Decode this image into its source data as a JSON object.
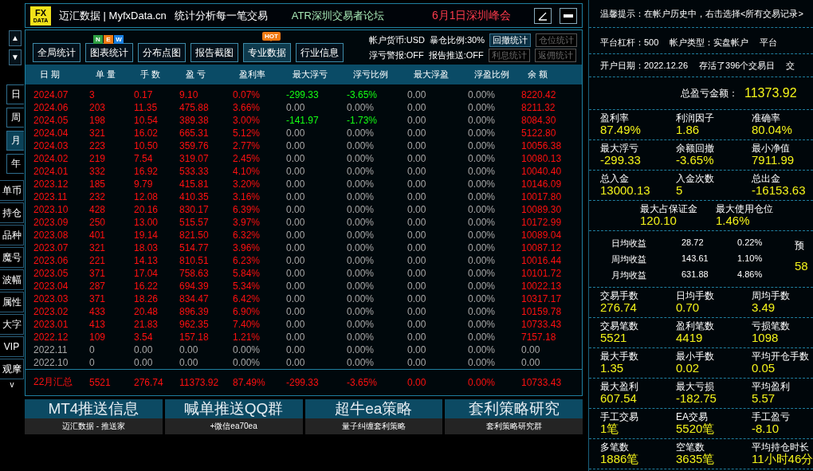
{
  "side_strip": {
    "arrows": [
      "▲",
      "▼"
    ],
    "period_tabs": [
      {
        "label": "日",
        "selected": false
      },
      {
        "label": "周",
        "selected": false
      },
      {
        "label": "月",
        "selected": true
      },
      {
        "label": "年",
        "selected": false
      }
    ],
    "items": [
      "单币",
      "持仓",
      "品种",
      "魔号",
      "波幅",
      "属性",
      "大字",
      "VIP",
      "观摩"
    ],
    "more": "v"
  },
  "title_bar": {
    "logo": {
      "top": "FX",
      "bottom": "DATA"
    },
    "brand": "迈汇数据 | MyfxData.cn",
    "slogan": "统计分析每一笔交易",
    "forum": "ATR深圳交易者论坛",
    "event": "6月1日深圳峰会"
  },
  "toolbar": {
    "tabs": [
      {
        "label": "全局统计",
        "selected": false
      },
      {
        "label": "图表统计",
        "selected": false,
        "badges": [
          {
            "text": "N",
            "color": "#2ea043"
          },
          {
            "text": "E",
            "color": "#f07a12"
          },
          {
            "text": "W",
            "color": "#1a7fe0"
          }
        ]
      },
      {
        "label": "分布点图",
        "selected": false
      },
      {
        "label": "报告截图",
        "selected": false
      },
      {
        "label": "专业数据",
        "selected": true,
        "badges": [
          {
            "text": "HOT",
            "color": "#f07a12"
          }
        ]
      },
      {
        "label": "行业信息",
        "selected": false
      }
    ],
    "info": [
      [
        "帐户货币:USD",
        "暴仓比例:30%"
      ],
      [
        "浮亏警报:OFF",
        "报告推送:OFF"
      ]
    ],
    "buttons": [
      [
        {
          "label": "回撤统计",
          "disabled": false
        },
        {
          "label": "仓位统计",
          "disabled": true
        }
      ],
      [
        {
          "label": "利息统计",
          "disabled": true
        },
        {
          "label": "返佣统计",
          "disabled": true
        }
      ]
    ]
  },
  "table": {
    "columns": [
      "日 期",
      "单 量",
      "手 数",
      "盈 亏",
      "盈利率",
      "最大浮亏",
      "浮亏比例",
      "最大浮盈",
      "浮盈比例",
      "余 额"
    ],
    "rows": [
      [
        {
          "text": "2024.07",
          "color": "#ff1010"
        },
        {
          "text": "3",
          "color": "#ff1010"
        },
        {
          "text": "0.17",
          "color": "#ff1010"
        },
        {
          "text": "9.10",
          "color": "#ff1010"
        },
        {
          "text": "0.07%",
          "color": "#ff1010"
        },
        {
          "text": "-299.33",
          "color": "#13ff13"
        },
        {
          "text": "-3.65%",
          "color": "#13ff13"
        },
        {
          "text": "0.00",
          "color": "#a8a8a8"
        },
        {
          "text": "0.00%",
          "color": "#a8a8a8"
        },
        {
          "text": "8220.42",
          "color": "#ff1010"
        }
      ],
      [
        {
          "text": "2024.06",
          "color": "#ff1010"
        },
        {
          "text": "203",
          "color": "#ff1010"
        },
        {
          "text": "11.35",
          "color": "#ff1010"
        },
        {
          "text": "475.88",
          "color": "#ff1010"
        },
        {
          "text": "3.66%",
          "color": "#ff1010"
        },
        {
          "text": "0.00",
          "color": "#a8a8a8"
        },
        {
          "text": "0.00%",
          "color": "#a8a8a8"
        },
        {
          "text": "0.00",
          "color": "#a8a8a8"
        },
        {
          "text": "0.00%",
          "color": "#a8a8a8"
        },
        {
          "text": "8211.32",
          "color": "#ff1010"
        }
      ],
      [
        {
          "text": "2024.05",
          "color": "#ff1010"
        },
        {
          "text": "198",
          "color": "#ff1010"
        },
        {
          "text": "10.54",
          "color": "#ff1010"
        },
        {
          "text": "389.38",
          "color": "#ff1010"
        },
        {
          "text": "3.00%",
          "color": "#ff1010"
        },
        {
          "text": "-141.97",
          "color": "#13ff13"
        },
        {
          "text": "-1.73%",
          "color": "#13ff13"
        },
        {
          "text": "0.00",
          "color": "#a8a8a8"
        },
        {
          "text": "0.00%",
          "color": "#a8a8a8"
        },
        {
          "text": "8084.30",
          "color": "#ff1010"
        }
      ],
      [
        {
          "text": "2024.04",
          "color": "#ff1010"
        },
        {
          "text": "321",
          "color": "#ff1010"
        },
        {
          "text": "16.02",
          "color": "#ff1010"
        },
        {
          "text": "665.31",
          "color": "#ff1010"
        },
        {
          "text": "5.12%",
          "color": "#ff1010"
        },
        {
          "text": "0.00",
          "color": "#a8a8a8"
        },
        {
          "text": "0.00%",
          "color": "#a8a8a8"
        },
        {
          "text": "0.00",
          "color": "#a8a8a8"
        },
        {
          "text": "0.00%",
          "color": "#a8a8a8"
        },
        {
          "text": "5122.80",
          "color": "#ff1010"
        }
      ],
      [
        {
          "text": "2024.03",
          "color": "#ff1010"
        },
        {
          "text": "223",
          "color": "#ff1010"
        },
        {
          "text": "10.50",
          "color": "#ff1010"
        },
        {
          "text": "359.76",
          "color": "#ff1010"
        },
        {
          "text": "2.77%",
          "color": "#ff1010"
        },
        {
          "text": "0.00",
          "color": "#a8a8a8"
        },
        {
          "text": "0.00%",
          "color": "#a8a8a8"
        },
        {
          "text": "0.00",
          "color": "#a8a8a8"
        },
        {
          "text": "0.00%",
          "color": "#a8a8a8"
        },
        {
          "text": "10056.38",
          "color": "#ff1010"
        }
      ],
      [
        {
          "text": "2024.02",
          "color": "#ff1010"
        },
        {
          "text": "219",
          "color": "#ff1010"
        },
        {
          "text": "7.54",
          "color": "#ff1010"
        },
        {
          "text": "319.07",
          "color": "#ff1010"
        },
        {
          "text": "2.45%",
          "color": "#ff1010"
        },
        {
          "text": "0.00",
          "color": "#a8a8a8"
        },
        {
          "text": "0.00%",
          "color": "#a8a8a8"
        },
        {
          "text": "0.00",
          "color": "#a8a8a8"
        },
        {
          "text": "0.00%",
          "color": "#a8a8a8"
        },
        {
          "text": "10080.13",
          "color": "#ff1010"
        }
      ],
      [
        {
          "text": "2024.01",
          "color": "#ff1010"
        },
        {
          "text": "332",
          "color": "#ff1010"
        },
        {
          "text": "16.92",
          "color": "#ff1010"
        },
        {
          "text": "533.33",
          "color": "#ff1010"
        },
        {
          "text": "4.10%",
          "color": "#ff1010"
        },
        {
          "text": "0.00",
          "color": "#a8a8a8"
        },
        {
          "text": "0.00%",
          "color": "#a8a8a8"
        },
        {
          "text": "0.00",
          "color": "#a8a8a8"
        },
        {
          "text": "0.00%",
          "color": "#a8a8a8"
        },
        {
          "text": "10040.40",
          "color": "#ff1010"
        }
      ],
      [
        {
          "text": "2023.12",
          "color": "#ff1010"
        },
        {
          "text": "185",
          "color": "#ff1010"
        },
        {
          "text": "9.79",
          "color": "#ff1010"
        },
        {
          "text": "415.81",
          "color": "#ff1010"
        },
        {
          "text": "3.20%",
          "color": "#ff1010"
        },
        {
          "text": "0.00",
          "color": "#a8a8a8"
        },
        {
          "text": "0.00%",
          "color": "#a8a8a8"
        },
        {
          "text": "0.00",
          "color": "#a8a8a8"
        },
        {
          "text": "0.00%",
          "color": "#a8a8a8"
        },
        {
          "text": "10146.09",
          "color": "#ff1010"
        }
      ],
      [
        {
          "text": "2023.11",
          "color": "#ff1010"
        },
        {
          "text": "232",
          "color": "#ff1010"
        },
        {
          "text": "12.08",
          "color": "#ff1010"
        },
        {
          "text": "410.35",
          "color": "#ff1010"
        },
        {
          "text": "3.16%",
          "color": "#ff1010"
        },
        {
          "text": "0.00",
          "color": "#a8a8a8"
        },
        {
          "text": "0.00%",
          "color": "#a8a8a8"
        },
        {
          "text": "0.00",
          "color": "#a8a8a8"
        },
        {
          "text": "0.00%",
          "color": "#a8a8a8"
        },
        {
          "text": "10017.80",
          "color": "#ff1010"
        }
      ],
      [
        {
          "text": "2023.10",
          "color": "#ff1010"
        },
        {
          "text": "428",
          "color": "#ff1010"
        },
        {
          "text": "20.16",
          "color": "#ff1010"
        },
        {
          "text": "830.17",
          "color": "#ff1010"
        },
        {
          "text": "6.39%",
          "color": "#ff1010"
        },
        {
          "text": "0.00",
          "color": "#a8a8a8"
        },
        {
          "text": "0.00%",
          "color": "#a8a8a8"
        },
        {
          "text": "0.00",
          "color": "#a8a8a8"
        },
        {
          "text": "0.00%",
          "color": "#a8a8a8"
        },
        {
          "text": "10089.30",
          "color": "#ff1010"
        }
      ],
      [
        {
          "text": "2023.09",
          "color": "#ff1010"
        },
        {
          "text": "250",
          "color": "#ff1010"
        },
        {
          "text": "13.00",
          "color": "#ff1010"
        },
        {
          "text": "515.57",
          "color": "#ff1010"
        },
        {
          "text": "3.97%",
          "color": "#ff1010"
        },
        {
          "text": "0.00",
          "color": "#a8a8a8"
        },
        {
          "text": "0.00%",
          "color": "#a8a8a8"
        },
        {
          "text": "0.00",
          "color": "#a8a8a8"
        },
        {
          "text": "0.00%",
          "color": "#a8a8a8"
        },
        {
          "text": "10172.99",
          "color": "#ff1010"
        }
      ],
      [
        {
          "text": "2023.08",
          "color": "#ff1010"
        },
        {
          "text": "401",
          "color": "#ff1010"
        },
        {
          "text": "19.14",
          "color": "#ff1010"
        },
        {
          "text": "821.50",
          "color": "#ff1010"
        },
        {
          "text": "6.32%",
          "color": "#ff1010"
        },
        {
          "text": "0.00",
          "color": "#a8a8a8"
        },
        {
          "text": "0.00%",
          "color": "#a8a8a8"
        },
        {
          "text": "0.00",
          "color": "#a8a8a8"
        },
        {
          "text": "0.00%",
          "color": "#a8a8a8"
        },
        {
          "text": "10089.04",
          "color": "#ff1010"
        }
      ],
      [
        {
          "text": "2023.07",
          "color": "#ff1010"
        },
        {
          "text": "321",
          "color": "#ff1010"
        },
        {
          "text": "18.03",
          "color": "#ff1010"
        },
        {
          "text": "514.77",
          "color": "#ff1010"
        },
        {
          "text": "3.96%",
          "color": "#ff1010"
        },
        {
          "text": "0.00",
          "color": "#a8a8a8"
        },
        {
          "text": "0.00%",
          "color": "#a8a8a8"
        },
        {
          "text": "0.00",
          "color": "#a8a8a8"
        },
        {
          "text": "0.00%",
          "color": "#a8a8a8"
        },
        {
          "text": "10087.12",
          "color": "#ff1010"
        }
      ],
      [
        {
          "text": "2023.06",
          "color": "#ff1010"
        },
        {
          "text": "221",
          "color": "#ff1010"
        },
        {
          "text": "14.13",
          "color": "#ff1010"
        },
        {
          "text": "810.51",
          "color": "#ff1010"
        },
        {
          "text": "6.23%",
          "color": "#ff1010"
        },
        {
          "text": "0.00",
          "color": "#a8a8a8"
        },
        {
          "text": "0.00%",
          "color": "#a8a8a8"
        },
        {
          "text": "0.00",
          "color": "#a8a8a8"
        },
        {
          "text": "0.00%",
          "color": "#a8a8a8"
        },
        {
          "text": "10016.44",
          "color": "#ff1010"
        }
      ],
      [
        {
          "text": "2023.05",
          "color": "#ff1010"
        },
        {
          "text": "371",
          "color": "#ff1010"
        },
        {
          "text": "17.04",
          "color": "#ff1010"
        },
        {
          "text": "758.63",
          "color": "#ff1010"
        },
        {
          "text": "5.84%",
          "color": "#ff1010"
        },
        {
          "text": "0.00",
          "color": "#a8a8a8"
        },
        {
          "text": "0.00%",
          "color": "#a8a8a8"
        },
        {
          "text": "0.00",
          "color": "#a8a8a8"
        },
        {
          "text": "0.00%",
          "color": "#a8a8a8"
        },
        {
          "text": "10101.72",
          "color": "#ff1010"
        }
      ],
      [
        {
          "text": "2023.04",
          "color": "#ff1010"
        },
        {
          "text": "287",
          "color": "#ff1010"
        },
        {
          "text": "16.22",
          "color": "#ff1010"
        },
        {
          "text": "694.39",
          "color": "#ff1010"
        },
        {
          "text": "5.34%",
          "color": "#ff1010"
        },
        {
          "text": "0.00",
          "color": "#a8a8a8"
        },
        {
          "text": "0.00%",
          "color": "#a8a8a8"
        },
        {
          "text": "0.00",
          "color": "#a8a8a8"
        },
        {
          "text": "0.00%",
          "color": "#a8a8a8"
        },
        {
          "text": "10022.13",
          "color": "#ff1010"
        }
      ],
      [
        {
          "text": "2023.03",
          "color": "#ff1010"
        },
        {
          "text": "371",
          "color": "#ff1010"
        },
        {
          "text": "18.26",
          "color": "#ff1010"
        },
        {
          "text": "834.47",
          "color": "#ff1010"
        },
        {
          "text": "6.42%",
          "color": "#ff1010"
        },
        {
          "text": "0.00",
          "color": "#a8a8a8"
        },
        {
          "text": "0.00%",
          "color": "#a8a8a8"
        },
        {
          "text": "0.00",
          "color": "#a8a8a8"
        },
        {
          "text": "0.00%",
          "color": "#a8a8a8"
        },
        {
          "text": "10317.17",
          "color": "#ff1010"
        }
      ],
      [
        {
          "text": "2023.02",
          "color": "#ff1010"
        },
        {
          "text": "433",
          "color": "#ff1010"
        },
        {
          "text": "20.48",
          "color": "#ff1010"
        },
        {
          "text": "896.39",
          "color": "#ff1010"
        },
        {
          "text": "6.90%",
          "color": "#ff1010"
        },
        {
          "text": "0.00",
          "color": "#a8a8a8"
        },
        {
          "text": "0.00%",
          "color": "#a8a8a8"
        },
        {
          "text": "0.00",
          "color": "#a8a8a8"
        },
        {
          "text": "0.00%",
          "color": "#a8a8a8"
        },
        {
          "text": "10159.78",
          "color": "#ff1010"
        }
      ],
      [
        {
          "text": "2023.01",
          "color": "#ff1010"
        },
        {
          "text": "413",
          "color": "#ff1010"
        },
        {
          "text": "21.83",
          "color": "#ff1010"
        },
        {
          "text": "962.35",
          "color": "#ff1010"
        },
        {
          "text": "7.40%",
          "color": "#ff1010"
        },
        {
          "text": "0.00",
          "color": "#a8a8a8"
        },
        {
          "text": "0.00%",
          "color": "#a8a8a8"
        },
        {
          "text": "0.00",
          "color": "#a8a8a8"
        },
        {
          "text": "0.00%",
          "color": "#a8a8a8"
        },
        {
          "text": "10733.43",
          "color": "#ff1010"
        }
      ],
      [
        {
          "text": "2022.12",
          "color": "#ff1010"
        },
        {
          "text": "109",
          "color": "#ff1010"
        },
        {
          "text": "3.54",
          "color": "#ff1010"
        },
        {
          "text": "157.18",
          "color": "#ff1010"
        },
        {
          "text": "1.21%",
          "color": "#ff1010"
        },
        {
          "text": "0.00",
          "color": "#a8a8a8"
        },
        {
          "text": "0.00%",
          "color": "#a8a8a8"
        },
        {
          "text": "0.00",
          "color": "#a8a8a8"
        },
        {
          "text": "0.00%",
          "color": "#a8a8a8"
        },
        {
          "text": "7157.18",
          "color": "#ff1010"
        }
      ],
      [
        {
          "text": "2022.11",
          "color": "#a8a8a8"
        },
        {
          "text": "0",
          "color": "#a8a8a8"
        },
        {
          "text": "0.00",
          "color": "#a8a8a8"
        },
        {
          "text": "0.00",
          "color": "#a8a8a8"
        },
        {
          "text": "0.00%",
          "color": "#a8a8a8"
        },
        {
          "text": "0.00",
          "color": "#a8a8a8"
        },
        {
          "text": "0.00%",
          "color": "#a8a8a8"
        },
        {
          "text": "0.00",
          "color": "#a8a8a8"
        },
        {
          "text": "0.00%",
          "color": "#a8a8a8"
        },
        {
          "text": "0.00",
          "color": "#a8a8a8"
        }
      ],
      [
        {
          "text": "2022.10",
          "color": "#a8a8a8"
        },
        {
          "text": "0",
          "color": "#a8a8a8"
        },
        {
          "text": "0.00",
          "color": "#a8a8a8"
        },
        {
          "text": "0.00",
          "color": "#a8a8a8"
        },
        {
          "text": "0.00%",
          "color": "#a8a8a8"
        },
        {
          "text": "0.00",
          "color": "#a8a8a8"
        },
        {
          "text": "0.00%",
          "color": "#a8a8a8"
        },
        {
          "text": "0.00",
          "color": "#a8a8a8"
        },
        {
          "text": "0.00%",
          "color": "#a8a8a8"
        },
        {
          "text": "0.00",
          "color": "#a8a8a8"
        }
      ]
    ],
    "summary": [
      "22月汇总",
      "5521",
      "276.74",
      "11373.92",
      "87.49%",
      "-299.33",
      "-3.65%",
      "0.00",
      "0.00%",
      "10733.43"
    ]
  },
  "banners": [
    {
      "title": "MT4推送信息",
      "caption": "迈汇数据 - 推送家"
    },
    {
      "title": "喊单推送QQ群",
      "caption": "+微信ea70ea"
    },
    {
      "title": "超牛ea策略",
      "caption": "量子纠缠套利策略"
    },
    {
      "title": "套利策略研究",
      "caption": "套利策略研究群"
    }
  ],
  "right_panel": {
    "tip": "温馨提示：在帐户历史中，右击选择<所有交易记录>",
    "info_rows": [
      [
        "平台杠杆：500",
        "帐户类型：实盘帐户",
        "平台"
      ],
      [
        "开户日期：2022.12.26",
        "存活了396个交易日",
        "交"
      ]
    ],
    "total": {
      "label": "总盈亏金额：",
      "value": "11373.92"
    },
    "groups_top": [
      {
        "shifted": false,
        "items": [
          {
            "label": "盈利率",
            "value": "87.49%"
          },
          {
            "label": "利润因子",
            "value": "1.86"
          },
          {
            "label": "准确率",
            "value": "80.04%"
          }
        ]
      },
      {
        "shifted": false,
        "items": [
          {
            "label": "最大浮亏",
            "value": "-299.33"
          },
          {
            "label": "余额回撤",
            "value": "-3.65%"
          },
          {
            "label": "最小净值",
            "value": "7911.99"
          }
        ]
      },
      {
        "shifted": false,
        "items": [
          {
            "label": "总入金",
            "value": "13000.13"
          },
          {
            "label": "入金次数",
            "value": "5"
          },
          {
            "label": "总出金",
            "value": "-16153.63"
          }
        ]
      },
      {
        "shifted": true,
        "items": [
          {
            "label": "最大占保证金",
            "value": "120.10"
          },
          {
            "label": "最大使用仓位",
            "value": "1.46%"
          }
        ]
      }
    ],
    "averages": {
      "rows": [
        [
          "日均收益",
          "28.72",
          "0.22%"
        ],
        [
          "周均收益",
          "143.61",
          "1.10%"
        ],
        [
          "月均收益",
          "631.88",
          "4.86%"
        ]
      ],
      "side_label": "预",
      "side_value": "58"
    },
    "groups_bottom": [
      {
        "shifted": false,
        "items": [
          {
            "label": "交易手数",
            "value": "276.74"
          },
          {
            "label": "日均手数",
            "value": "0.70"
          },
          {
            "label": "周均手数",
            "value": "3.49"
          }
        ]
      },
      {
        "shifted": false,
        "items": [
          {
            "label": "交易笔数",
            "value": "5521"
          },
          {
            "label": "盈利笔数",
            "value": "4419"
          },
          {
            "label": "亏损笔数",
            "value": "1098"
          }
        ]
      },
      {
        "shifted": false,
        "items": [
          {
            "label": "最大手数",
            "value": "1.35"
          },
          {
            "label": "最小手数",
            "value": "0.02"
          },
          {
            "label": "平均开仓手数",
            "value": "0.05"
          }
        ]
      },
      {
        "shifted": false,
        "items": [
          {
            "label": "最大盈利",
            "value": "607.54"
          },
          {
            "label": "最大亏损",
            "value": "-182.75"
          },
          {
            "label": "平均盈利",
            "value": "5.57"
          }
        ]
      },
      {
        "shifted": false,
        "items": [
          {
            "label": "手工交易",
            "value": "1笔"
          },
          {
            "label": "EA交易",
            "value": "5520笔"
          },
          {
            "label": "手工盈亏",
            "value": "-8.10"
          }
        ]
      },
      {
        "shifted": false,
        "items": [
          {
            "label": "多笔数",
            "value": "1886笔"
          },
          {
            "label": "空笔数",
            "value": "3635笔"
          },
          {
            "label": "平均持仓时长",
            "value": "11小时46分"
          }
        ]
      }
    ]
  }
}
